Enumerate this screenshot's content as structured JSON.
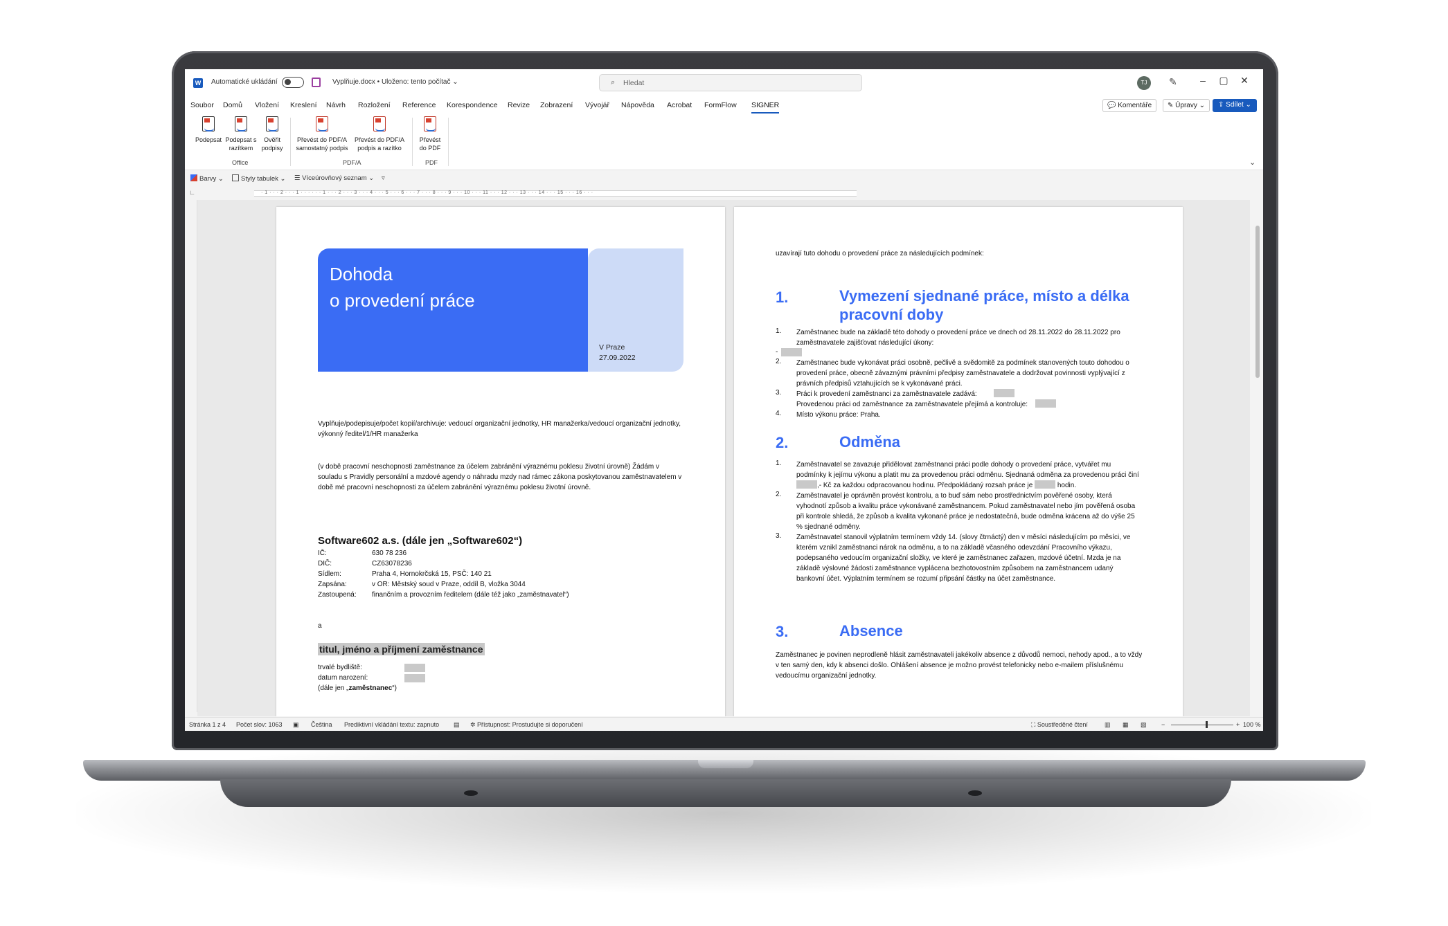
{
  "titlebar": {
    "autosave_label": "Automatické ukládání",
    "doc_name": "Vyplňuje.docx • Uloženo: tento počítač ⌄",
    "search_placeholder": "Hledat",
    "avatar_initials": "TJ"
  },
  "menu": {
    "tabs": [
      "Soubor",
      "Domů",
      "Vložení",
      "Kreslení",
      "Návrh",
      "Rozložení",
      "Reference",
      "Korespondence",
      "Revize",
      "Zobrazení",
      "Vývojář",
      "Nápověda",
      "Acrobat",
      "FormFlow",
      "SIGNER"
    ],
    "active_tab": "SIGNER",
    "comments_label": "Komentáře",
    "edits_label": "Úpravy ⌄",
    "share_label": "Sdílet  ⌄"
  },
  "ribbon": {
    "buttons": [
      {
        "label": "Podepsat"
      },
      {
        "label": "Podepsat s razítkem"
      },
      {
        "label": "Ověřit podpisy"
      },
      {
        "label": "Převést do PDF/A samostatný podpis"
      },
      {
        "label": "Převést do PDF/A podpis a razítko"
      },
      {
        "label": "Převést do PDF"
      }
    ],
    "groups": [
      "Office",
      "PDF/A",
      "PDF"
    ]
  },
  "toolbar2": {
    "colors_label": "Barvy ⌄",
    "table_styles_label": "Styly tabulek ⌄",
    "multilevel_label": "Víceúrovňový seznam ⌄"
  },
  "ruler": "· 1 · · · 2 · · · 1 · · · · · · 1 · · · 2 · · · 3 · · · 4 · · · 5 · · · 6 · · · 7 · · · 8 · · · 9 · · · 10 · · · 11 · · · 12 · · · 13 · · · 14 · · · 15 · · · 16 · · ·",
  "page1": {
    "hero_title_line1": "Dohoda",
    "hero_title_line2": "o provedení práce",
    "place": "V Praze",
    "date": "27.09.2022",
    "fill_note": "Vyplňuje/podepisuje/počet kopií/archivuje: vedoucí organizační jednotky, HR manažerka/vedoucí organizační jednotky, výkonný ředitel/1/HR manažerka",
    "request": "(v době pracovní neschopnosti zaměstnance za účelem zabránění výraznému poklesu životní úrovně) Žádám v souladu s Pravidly personální a mzdové agendy o náhradu mzdy nad rámec zákona poskytovanou zaměstnavatelem v době mé pracovní neschopnosti za účelem zabránění výraznému poklesu životní úrovně.",
    "company_name": "Software602 a.s. (dále jen „Software602“)",
    "company_info": [
      {
        "key": "IČ:",
        "value": "630 78 236"
      },
      {
        "key": "DIČ:",
        "value": "CZ63078236"
      },
      {
        "key": "Sídlem:",
        "value": "Praha 4, Hornokrčská 15, PSČ: 140 21"
      },
      {
        "key": "Zapsána:",
        "value": "v OR: Městský soud v Praze, oddíl B, vložka 3044"
      },
      {
        "key": "Zastoupená:",
        "value": "finančním a provozním ředitelem (dále též jako „zaměstnavatel“)"
      }
    ],
    "and": "a",
    "employee_heading": "titul, jméno a příjmení zaměstnance",
    "residence_label": "trvalé bydliště:",
    "birth_label": "datum narození:",
    "employee_ref_prefix": "(dále jen „",
    "employee_ref_bold": "zaměstnanec",
    "employee_ref_suffix": "“)"
  },
  "page2": {
    "intro": "uzavírají tuto dohodu o provedení práce za následujících podmínek:",
    "sections": [
      {
        "num": "1.",
        "title": "Vymezení sjednané práce, místo a délka pracovní doby"
      },
      {
        "num": "2.",
        "title": "Odměna"
      },
      {
        "num": "3.",
        "title": "Absence"
      }
    ],
    "s1_items": [
      {
        "num": "1.",
        "text": "Zaměstnanec bude na základě této dohody o provedení práce ve dnech od 28.11.2022 do 28.11.2022 pro zaměstnavatele zajišťovat následující úkony:"
      },
      {
        "num": "2.",
        "text": "Zaměstnanec bude vykonávat práci osobně, pečlivě a svědomitě za podmínek stanovených touto dohodou o provedení práce, obecně závaznými právními předpisy zaměstnavatele a dodržovat povinnosti vyplývající z právních předpisů vztahujících se k vykonávané práci."
      },
      {
        "num": "3.",
        "text": "Práci k provedení zaměstnanci za zaměstnavatele zadává:"
      },
      {
        "num": "",
        "text": "Provedenou práci od zaměstnance za zaměstnavatele přejímá a kontroluje:"
      },
      {
        "num": "4.",
        "text": "Místo výkonu práce: Praha."
      }
    ],
    "s1_dash": "-",
    "s2_items": [
      {
        "num": "1.",
        "text_a": "Zaměstnavatel se zavazuje přidělovat zaměstnanci práci podle dohody o provedení práce, vytvářet mu podmínky k jejímu výkonu a platit mu za provedenou práci odměnu. Sjednaná odměna za provedenou práci činí",
        "text_b": ",- Kč za každou odpracovanou hodinu. Předpokládaný rozsah práce je",
        "text_c": "hodin."
      },
      {
        "num": "2.",
        "text": "Zaměstnavatel je oprávněn provést kontrolu, a to buď sám nebo prostřednictvím pověřené osoby, která vyhodnotí způsob a kvalitu práce vykonávané zaměstnancem. Pokud zaměstnavatel nebo jím pověřená osoba při kontrole shledá, že způsob a kvalita vykonané práce je nedostatečná, bude odměna krácena až do výše 25 % sjednané odměny."
      },
      {
        "num": "3.",
        "text": "Zaměstnavatel stanovil výplatním termínem vždy 14. (slovy čtrnáctý) den v měsíci následujícím po měsíci, ve kterém vznikl zaměstnanci nárok na odměnu, a to na základě včasného odevzdání Pracovního výkazu, podepsaného vedoucím organizační složky, ve které je zaměstnanec zařazen, mzdové účetní. Mzda je na základě výslovné žádosti zaměstnance vyplácena bezhotovostním způsobem na zaměstnancem udaný bankovní účet. Výplatním termínem se rozumí připsání částky na účet zaměstnance."
      }
    ],
    "s3_text": "Zaměstnanec je povinen neprodleně hlásit zaměstnavateli jakékoliv absence z důvodů nemoci, nehody apod., a to vždy v ten samý den, kdy k absenci došlo. Ohlášení absence je možno provést telefonicky nebo e-mailem příslušnému vedoucímu organizační jednotky."
  },
  "statusbar": {
    "page": "Stránka 1 z 4",
    "words": "Počet slov: 1063",
    "language": "Čeština",
    "predictive": "Prediktivní vkládání textu: zapnuto",
    "accessibility": "Přístupnost: Prostudujte si doporučení",
    "focus": "Soustředěné čtení",
    "zoom_minus": "−",
    "zoom_plus": "+",
    "zoom": "100 %"
  }
}
